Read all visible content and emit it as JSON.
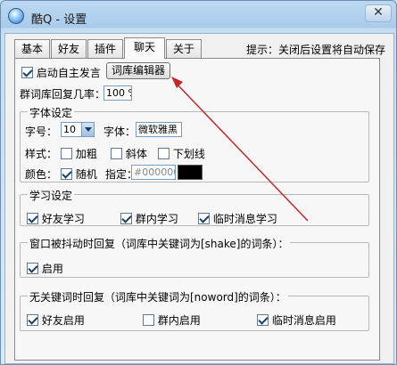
{
  "window": {
    "title": "酷Q - 设置",
    "close_glyph": "✕"
  },
  "tabs": [
    {
      "label": "基本",
      "active": false
    },
    {
      "label": "好友",
      "active": false
    },
    {
      "label": "插件",
      "active": false
    },
    {
      "label": "聊天",
      "active": true
    },
    {
      "label": "关于",
      "active": false
    }
  ],
  "hint": "提示：关闭后设置将自动保存",
  "chat": {
    "auto_speak_label": "启动自主发言",
    "auto_speak_checked": true,
    "lexicon_editor_button": "词库编辑器",
    "group_reply_rate_label": "群词库回复几率：",
    "group_reply_rate_value": "100 %"
  },
  "font_settings": {
    "group_title": "字体设定",
    "size_label": "字号：",
    "size_value": "10",
    "font_label": "字体：",
    "font_value": "微软雅黑",
    "style_label": "样式：",
    "bold_label": "加粗",
    "bold_checked": false,
    "italic_label": "斜体",
    "italic_checked": false,
    "underline_label": "下划线",
    "underline_checked": false,
    "color_label": "颜色：",
    "random_label": "随机",
    "random_checked": true,
    "specify_label": "指定：",
    "specify_value": "#000000",
    "swatch_color": "#000000"
  },
  "learning": {
    "group_title": "学习设定",
    "friend_learning_label": "好友学习",
    "friend_learning_checked": true,
    "group_learning_label": "群内学习",
    "group_learning_checked": true,
    "temp_learning_label": "临时消息学习",
    "temp_learning_checked": true
  },
  "shake_reply": {
    "group_title": "窗口被抖动时回复（词库中关键词为[shake]的词条）：",
    "enable_label": "启用",
    "enable_checked": true
  },
  "noword_reply": {
    "group_title": "无关键词时回复（词库中关键词为[noword]的词条）：",
    "friend_enable_label": "好友启用",
    "friend_enable_checked": true,
    "group_enable_label": "群内启用",
    "group_enable_checked": false,
    "temp_enable_label": "临时消息启用",
    "temp_enable_checked": true
  },
  "annotation": {
    "arrow_color": "#c0282a"
  }
}
